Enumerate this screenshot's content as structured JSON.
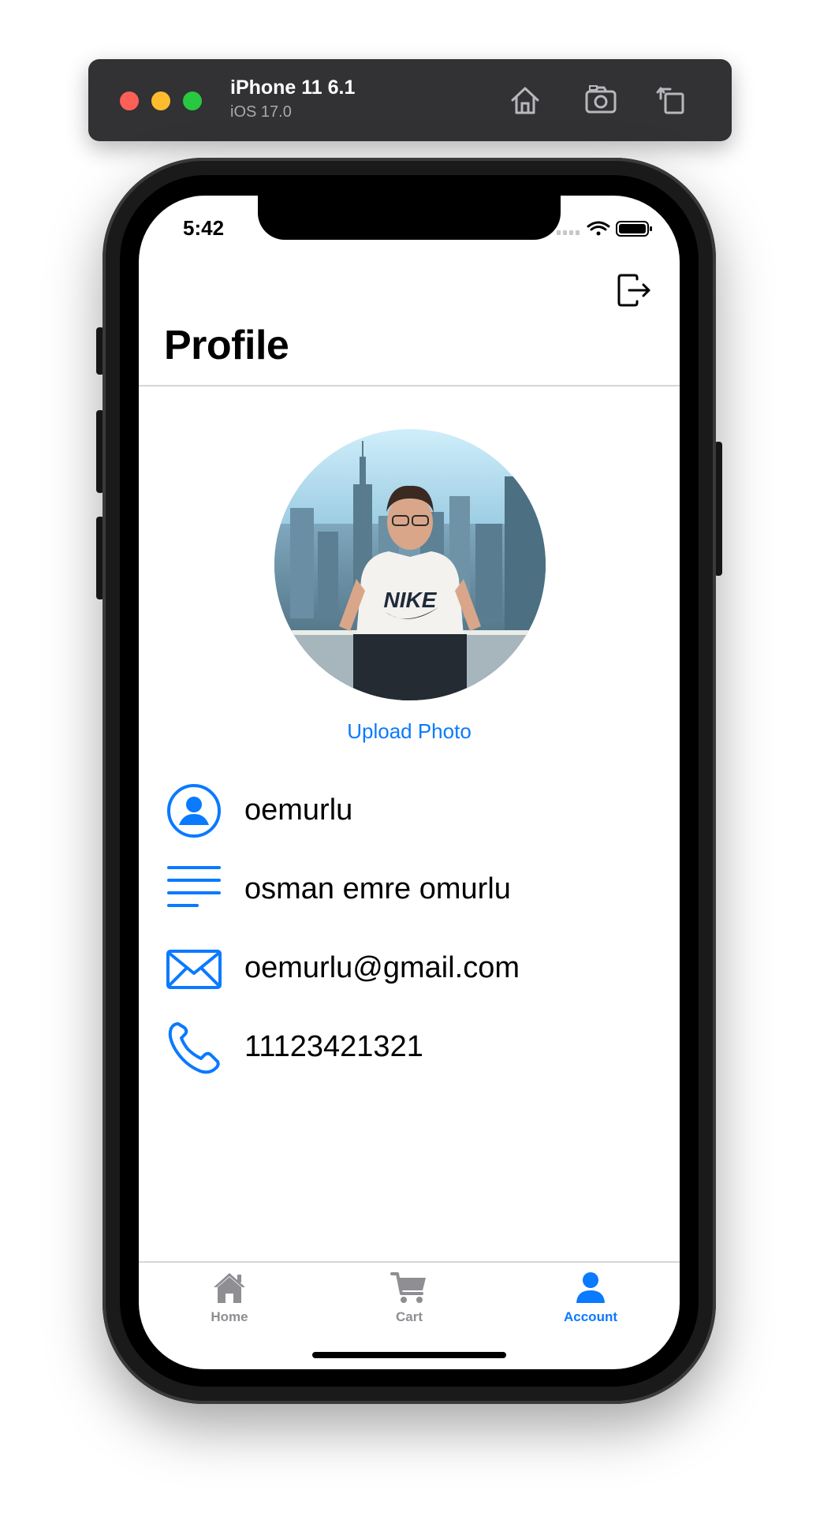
{
  "simulator": {
    "device_name": "iPhone 11 6.1",
    "os_version": "iOS 17.0",
    "toolbar_icons": [
      "home-icon",
      "screenshot-icon",
      "rotate-icon"
    ]
  },
  "status_bar": {
    "time": "5:42",
    "icons": [
      "cellular-icon",
      "wifi-icon",
      "battery-icon"
    ]
  },
  "nav": {
    "title": "Profile",
    "logout_icon": "logout-icon"
  },
  "profile": {
    "upload_label": "Upload Photo",
    "username": "oemurlu",
    "full_name": "osman emre omurlu",
    "email": "oemurlu@gmail.com",
    "phone": "11123421321",
    "icons": [
      "person-circle-icon",
      "text-lines-icon",
      "envelope-icon",
      "phone-icon"
    ]
  },
  "tab_bar": {
    "tabs": [
      {
        "label": "Home",
        "icon": "house-icon",
        "selected": false
      },
      {
        "label": "Cart",
        "icon": "cart-icon",
        "selected": false
      },
      {
        "label": "Account",
        "icon": "person-icon",
        "selected": true
      }
    ]
  },
  "colors": {
    "accent": "#0A7AFF",
    "inactive_tab": "#8E8E93",
    "text": "#000000",
    "toolbar_bg": "#323134"
  }
}
